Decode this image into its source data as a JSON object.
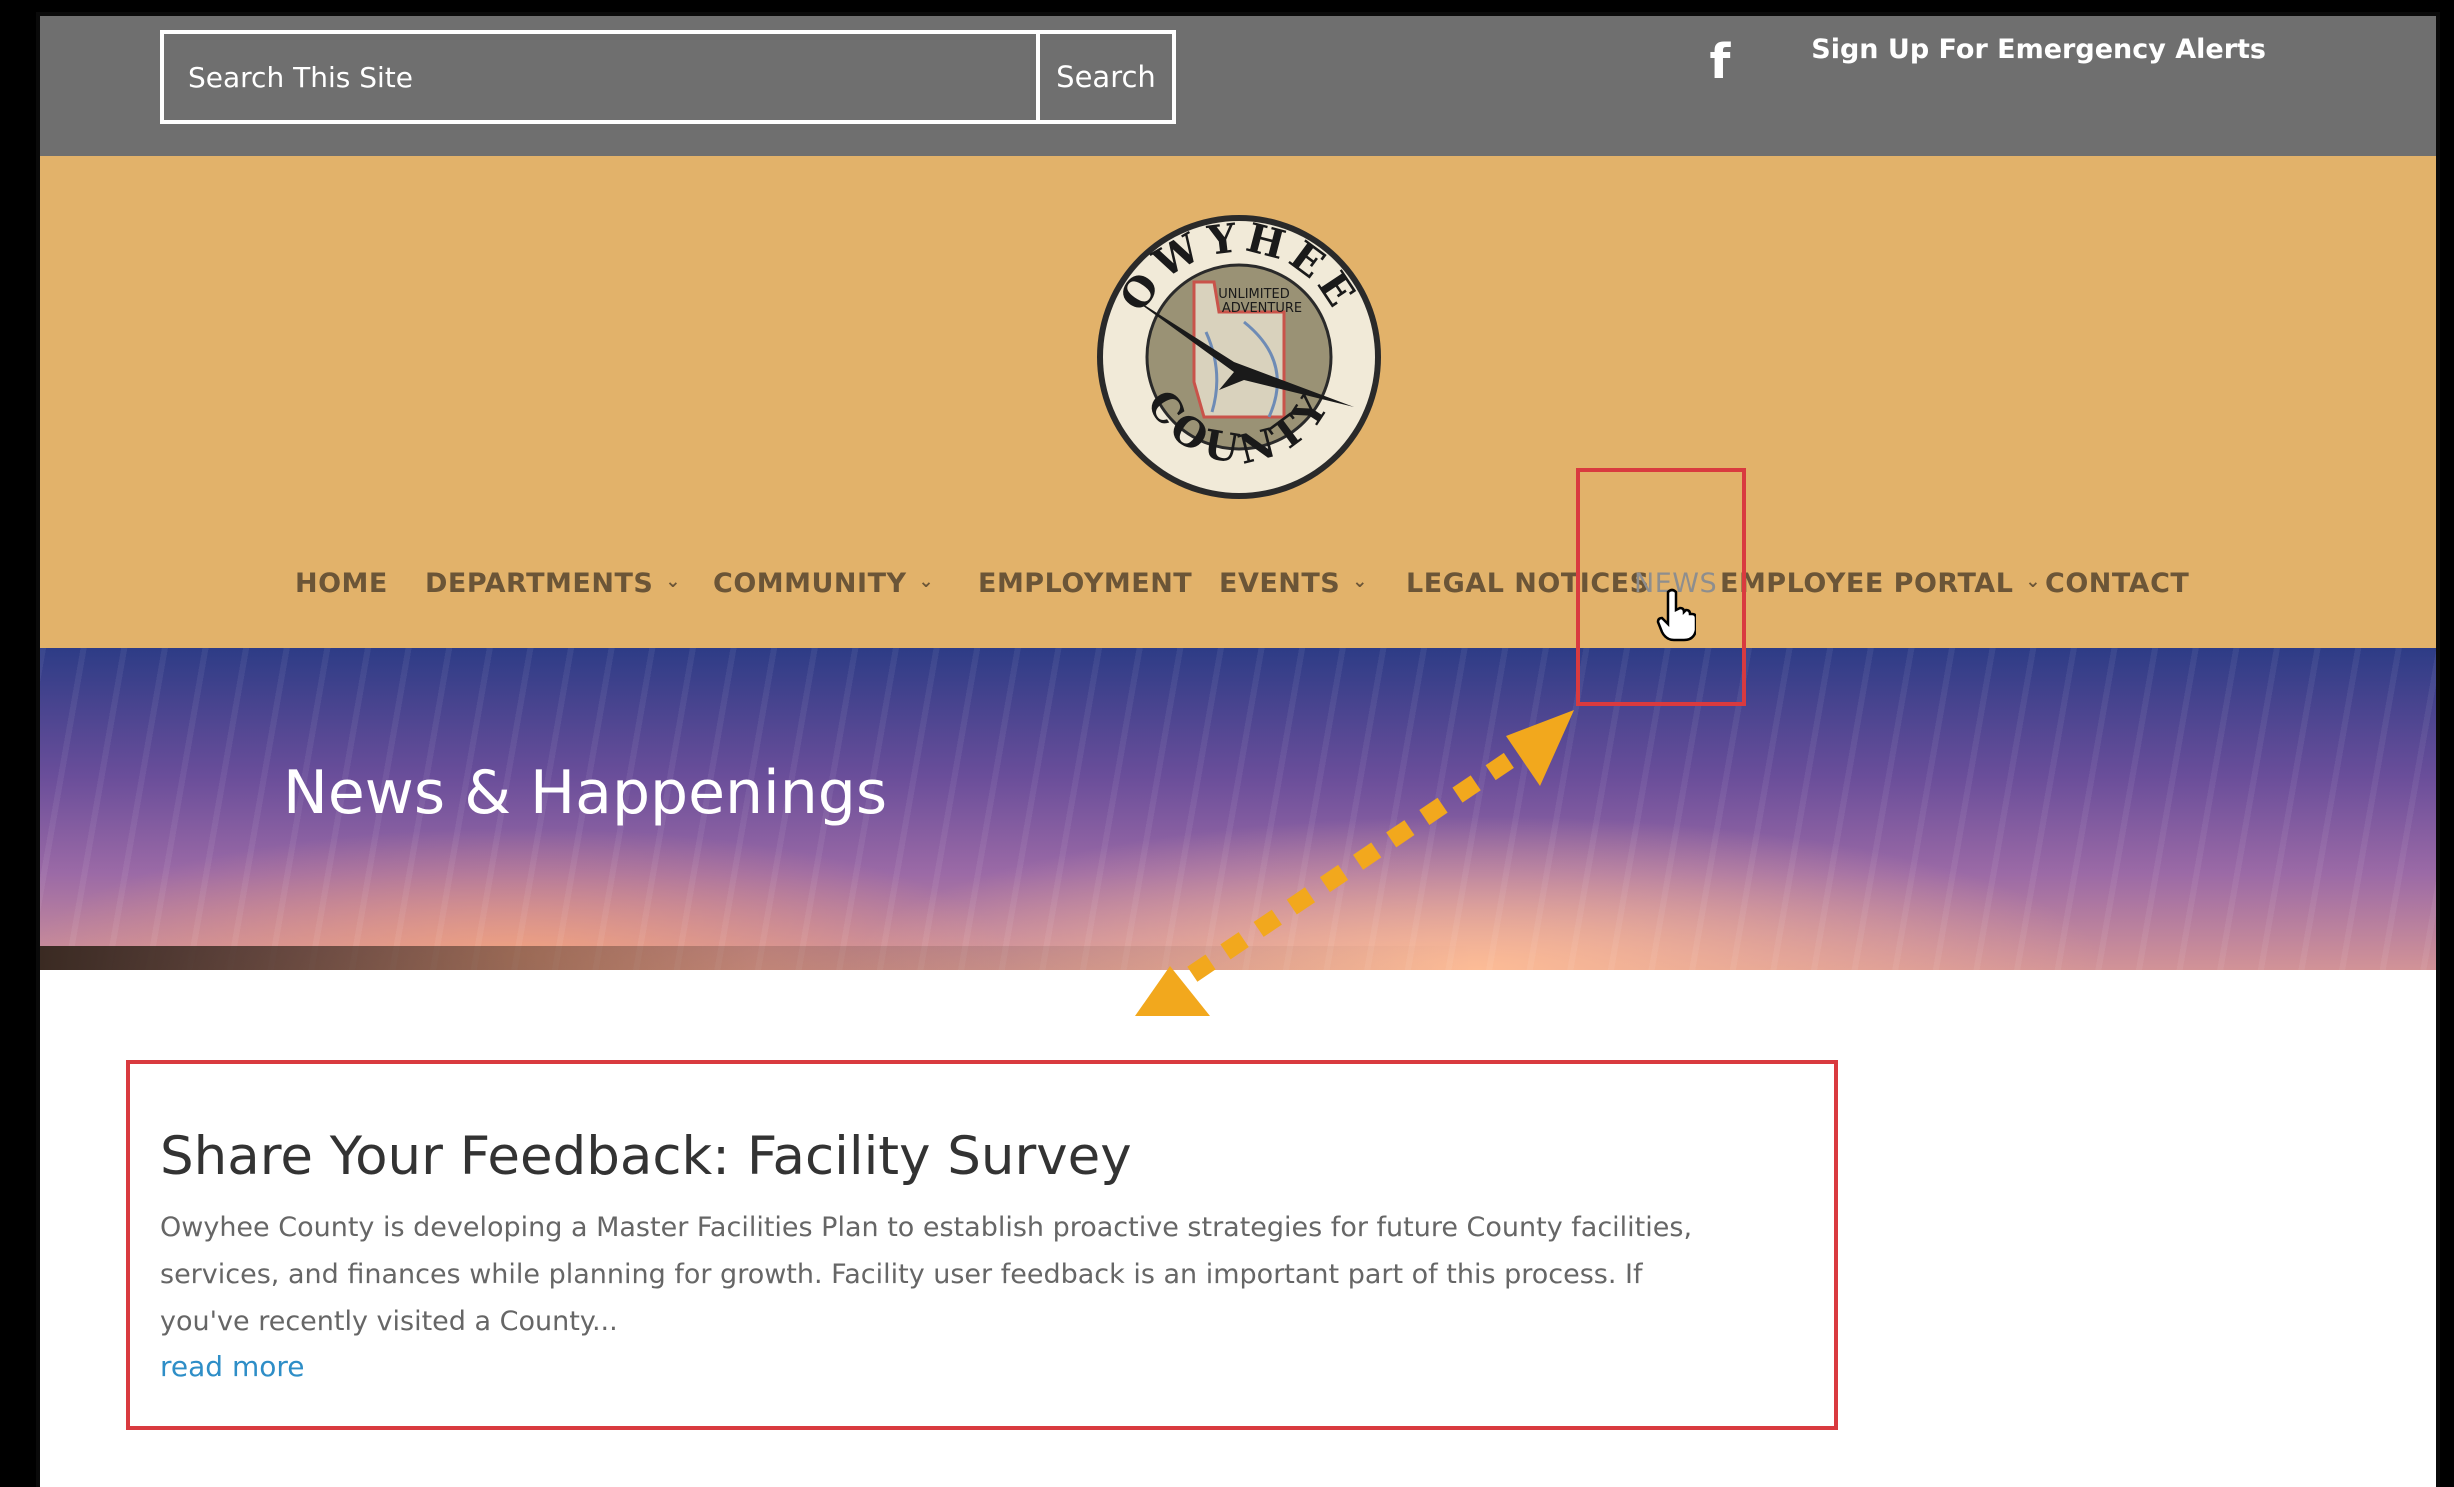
{
  "topbar": {
    "search_placeholder": "Search This Site",
    "search_button": "Search",
    "facebook_glyph": "f",
    "alert_link": "Sign Up For Emergency Alerts"
  },
  "logo": {
    "ring_text_top": "OWYHEE",
    "ring_text_bottom": "COUNTY",
    "tagline_1": "UNLIMITED",
    "tagline_2": "ADVENTURE"
  },
  "nav": {
    "items": [
      {
        "label": "HOME",
        "has_dropdown": false
      },
      {
        "label": "DEPARTMENTS",
        "has_dropdown": true
      },
      {
        "label": "COMMUNITY",
        "has_dropdown": true
      },
      {
        "label": "EMPLOYMENT",
        "has_dropdown": false
      },
      {
        "label": "EVENTS",
        "has_dropdown": true
      },
      {
        "label": "LEGAL NOTICES",
        "has_dropdown": false
      },
      {
        "label": "NEWS",
        "has_dropdown": false,
        "active": true
      },
      {
        "label": "EMPLOYEE PORTAL",
        "has_dropdown": true
      },
      {
        "label": "CONTACT",
        "has_dropdown": false
      }
    ],
    "dropdown_glyph": "⌄"
  },
  "hero": {
    "title": "News & Happenings"
  },
  "post": {
    "title": "Share Your Feedback: Facility Survey",
    "excerpt": "Owyhee County is developing a Master Facilities Plan to establish proactive strategies for future County facilities, services, and finances while planning for growth. Facility user feedback is an important part of this process. If you've recently visited a County...",
    "read_more": "read more"
  },
  "colors": {
    "topbar_bg": "#6f6f6f",
    "header_bg": "#e2b26a",
    "nav_text": "#6b5537",
    "nav_active": "#8e8e8e",
    "annotation_red": "#d93a3f",
    "annotation_arrow": "#f2a81d",
    "link_blue": "#2e8ec7"
  },
  "icons": {
    "facebook": "facebook-icon",
    "pointer": "hand-pointer-icon",
    "chevron": "chevron-down-icon"
  }
}
